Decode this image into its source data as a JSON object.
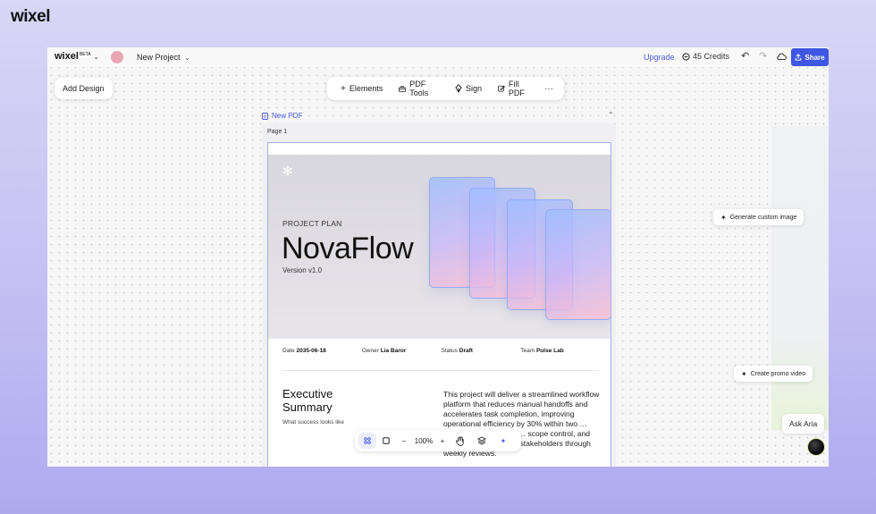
{
  "brand": "wixel",
  "topbar": {
    "logo": "wixel",
    "logo_badge": "BETA",
    "project_name": "New Project",
    "upgrade_label": "Upgrade",
    "credits_label": "45 Credits",
    "share_label": "Share",
    "avatar_color": "#eba6b6"
  },
  "canvas": {
    "add_design_label": "Add Design",
    "toolbar": {
      "elements_label": "Elements",
      "pdf_tools_label": "PDF Tools",
      "sign_label": "Sign",
      "fill_pdf_label": "Fill PDF",
      "more_label": "···"
    },
    "doc_tab_label": "New PDF",
    "page_label": "Page 1"
  },
  "document": {
    "kicker": "PROJECT PLAN",
    "title": "NovaFlow",
    "version": "Version v1.0",
    "meta": {
      "date_label": "Date",
      "date_value": "2035-06-18",
      "owner_label": "Owner",
      "owner_value": "Lia Baror",
      "status_label": "Status",
      "status_value": "Draft",
      "team_label": "Team",
      "team_value": "Pulse Lab"
    },
    "exec_title": "Executive Summary",
    "exec_sub": "What success looks like",
    "exec_body": "This project will deliver a streamlined workflow platform that reduces manual handoffs and accelerates task completion, improving operational efficiency by 30% within two … phased increments to … scope control, and align decisions across stakeholders through weekly reviews."
  },
  "side": {
    "generate_image_label": "Generate custom image",
    "promo_video_label": "Create promo video",
    "ask_aria_label": "Ask Aria"
  },
  "bottom_bar": {
    "zoom": "100%",
    "minus": "−",
    "plus": "+"
  },
  "colors": {
    "accent": "#3f57e3",
    "link": "#4a5be0",
    "selection": "#a7adf2"
  }
}
